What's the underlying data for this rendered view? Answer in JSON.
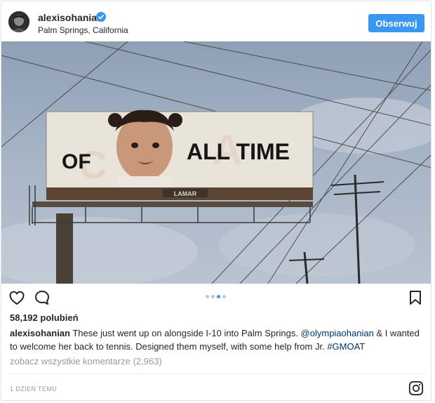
{
  "header": {
    "username": "alexisohanian",
    "location": "Palm Springs, California",
    "follow_label": "Obserwuj"
  },
  "photo": {
    "billboard_text_left": "OF",
    "billboard_text_right": "ALL TIME",
    "billboard_brand": "LAMAR"
  },
  "carousel": {
    "count": 4,
    "active_index": 2
  },
  "likes_text": "58,192 polubień",
  "caption": {
    "username": "alexisohanian",
    "part1": " These just went up on alongside I-10 into Palm Springs. ",
    "mention": "@olympiaohanian",
    "part2": " & I wanted to welcome her back to tennis. Designed them myself, with some help from Jr. ",
    "hashtag": "#GMOAT"
  },
  "comments_link": "zobacz wszystkie komentarze (2,963)",
  "timestamp": "1 DZIEŃ TEMU",
  "colors": {
    "accent": "#3897f0",
    "link": "#003569",
    "muted": "#999999",
    "text": "#262626"
  },
  "icons": [
    "verified-badge-icon",
    "heart-icon",
    "comment-icon",
    "bookmark-icon",
    "instagram-icon"
  ]
}
